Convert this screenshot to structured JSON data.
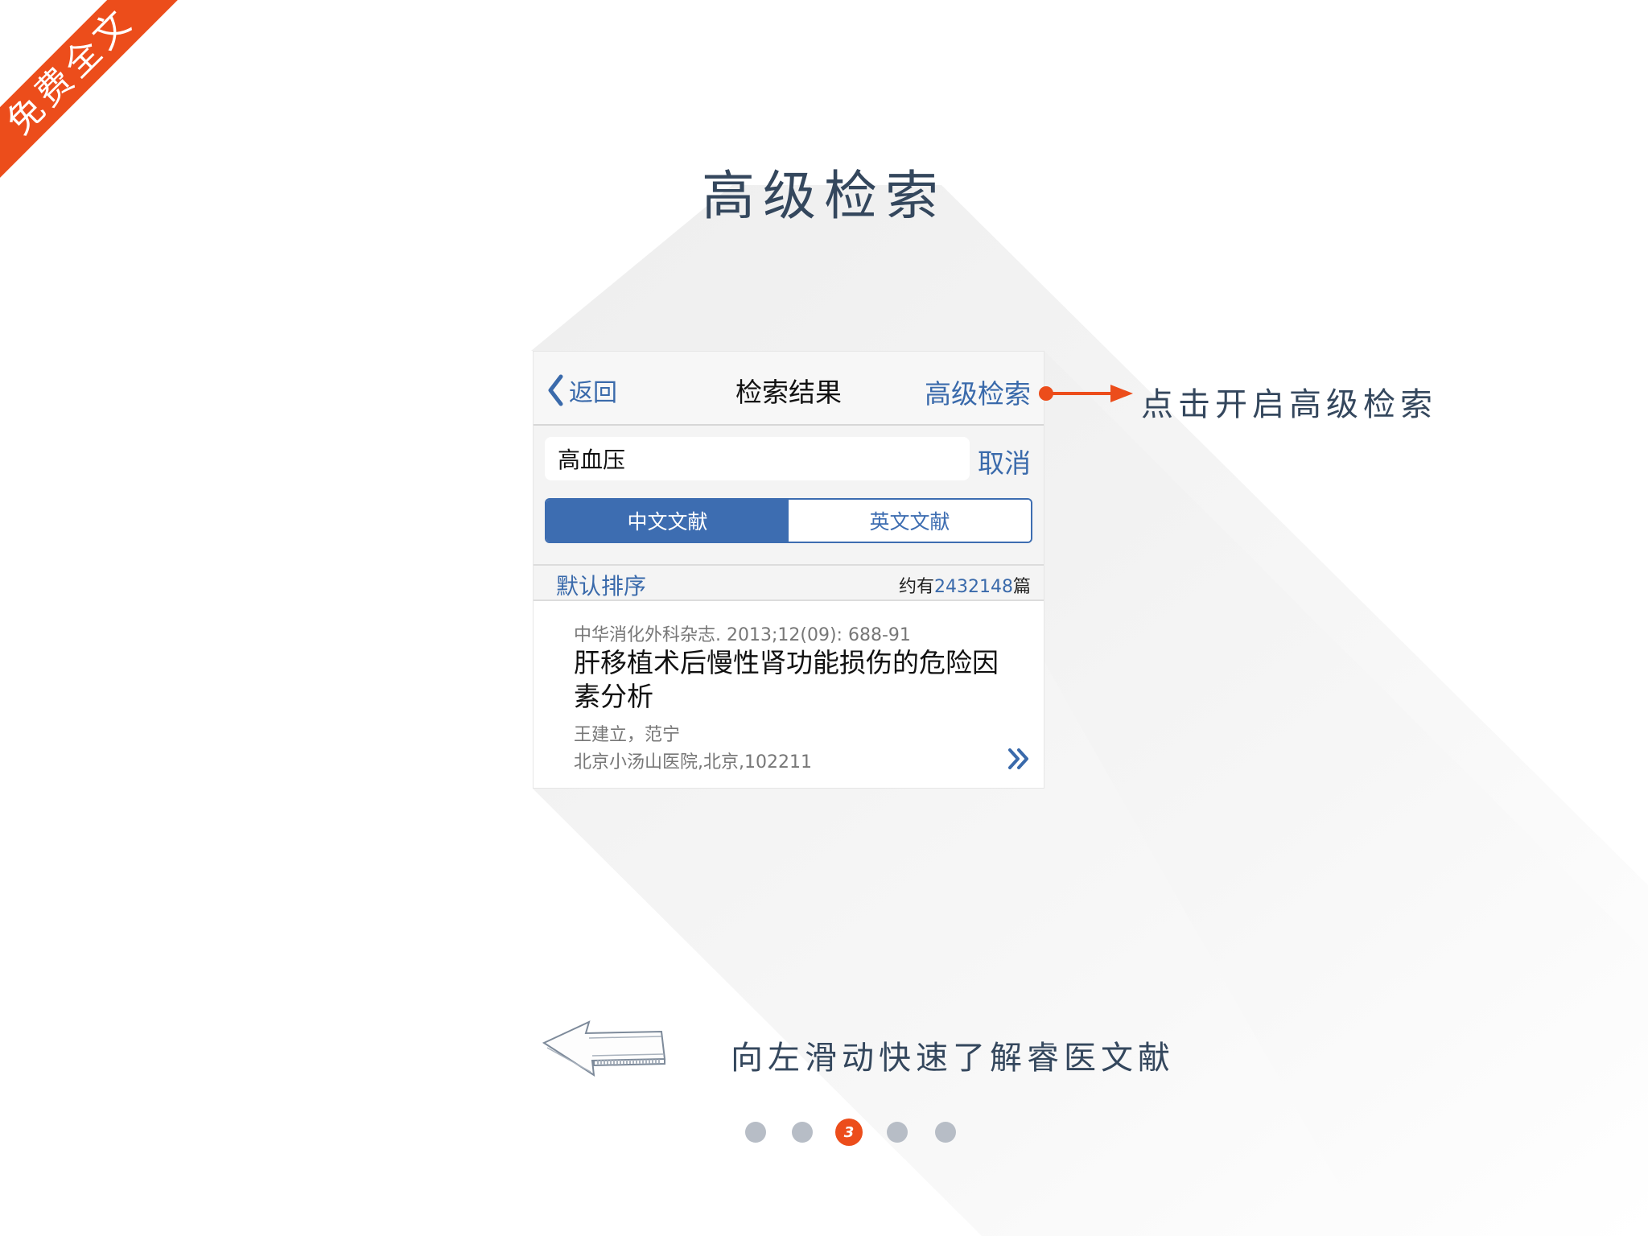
{
  "ribbon": {
    "text": "免费全文"
  },
  "page_title": "高级检索",
  "card": {
    "nav": {
      "back_label": "返回",
      "title": "检索结果",
      "advanced_label": "高级检索"
    },
    "search": {
      "value": "高血压",
      "cancel_label": "取消"
    },
    "segment": {
      "tabs": [
        "中文文献",
        "英文文献"
      ],
      "active_index": 0
    },
    "sort": {
      "label": "默认排序",
      "count_prefix": "约有",
      "count_value": "2432148",
      "count_suffix": "篇"
    },
    "result": {
      "source": "中华消化外科杂志. 2013;12(09): 688-91",
      "title": "肝移植术后慢性肾功能损伤的危险因素分析",
      "authors": "王建立，范宁",
      "affiliation": "北京小汤山医院,北京,102211",
      "more_icon": "double-chevron-right-icon"
    }
  },
  "annotation": {
    "text": "点击开启高级检索"
  },
  "swipe_hint": {
    "text": "向左滑动快速了解睿医文献",
    "icon": "left-arrow-sketch-icon"
  },
  "pagination": {
    "total": 5,
    "current": 3,
    "current_label": "3"
  },
  "colors": {
    "accent": "#ec4d1b",
    "link_blue": "#3a6aab",
    "title_ink": "#34475d",
    "dot_gray": "#b7bdc6"
  }
}
